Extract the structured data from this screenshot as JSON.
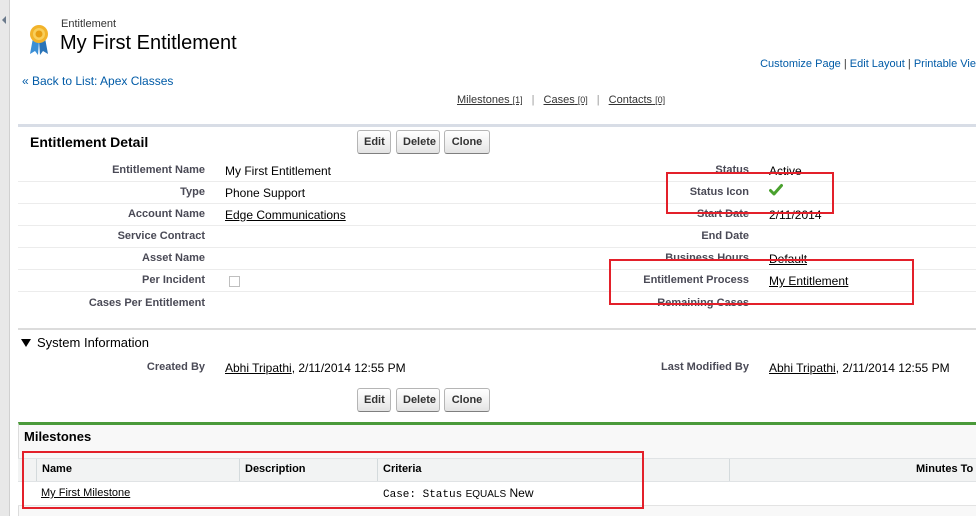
{
  "header": {
    "object_label": "Entitlement",
    "title": "My First Entitlement",
    "links": [
      "Customize Page",
      "Edit Layout",
      "Printable Vie"
    ],
    "back_link": "« Back to List: Apex Classes"
  },
  "related_list_links": [
    {
      "label": "Milestones",
      "count": "[1]"
    },
    {
      "label": "Cases",
      "count": "[0]"
    },
    {
      "label": "Contacts",
      "count": "[0]"
    }
  ],
  "detail": {
    "section_title": "Entitlement Detail",
    "buttons": [
      "Edit",
      "Delete",
      "Clone"
    ],
    "left_fields": [
      {
        "label": "Entitlement Name",
        "value": "My First Entitlement"
      },
      {
        "label": "Type",
        "value": "Phone Support"
      },
      {
        "label": "Account Name",
        "value": "Edge Communications"
      },
      {
        "label": "Service Contract",
        "value": ""
      },
      {
        "label": "Asset Name",
        "value": ""
      },
      {
        "label": "Per Incident",
        "value": ""
      },
      {
        "label": "Cases Per Entitlement",
        "value": ""
      }
    ],
    "right_fields": [
      {
        "label": "Status",
        "value": "Active"
      },
      {
        "label": "Status Icon",
        "value": ""
      },
      {
        "label": "Start Date",
        "value": "2/11/2014"
      },
      {
        "label": "End Date",
        "value": ""
      },
      {
        "label": "Business Hours",
        "value": "Default"
      },
      {
        "label": "Entitlement Process",
        "value": "My Entitlement"
      },
      {
        "label": "Remaining Cases",
        "value": ""
      }
    ]
  },
  "system_info": {
    "title": "System Information",
    "created_by_label": "Created By",
    "created_by_user": "Abhi Tripathi",
    "created_by_date": ", 2/11/2014 12:55 PM",
    "modified_by_label": "Last Modified By",
    "modified_by_user": "Abhi Tripathi",
    "modified_by_date": ", 2/11/2014 12:55 PM"
  },
  "milestones": {
    "title": "Milestones",
    "columns": [
      "Name",
      "Description",
      "Criteria",
      "Minutes To"
    ],
    "rows": [
      {
        "name": "My First Milestone",
        "description": "",
        "criteria_field": "Case: Status",
        "criteria_op": "EQUALS",
        "criteria_value": "New"
      }
    ]
  },
  "colors": {
    "highlight_box": "#e3202a",
    "milestones_accent": "#4a9a3a",
    "link": "#015ba7"
  }
}
